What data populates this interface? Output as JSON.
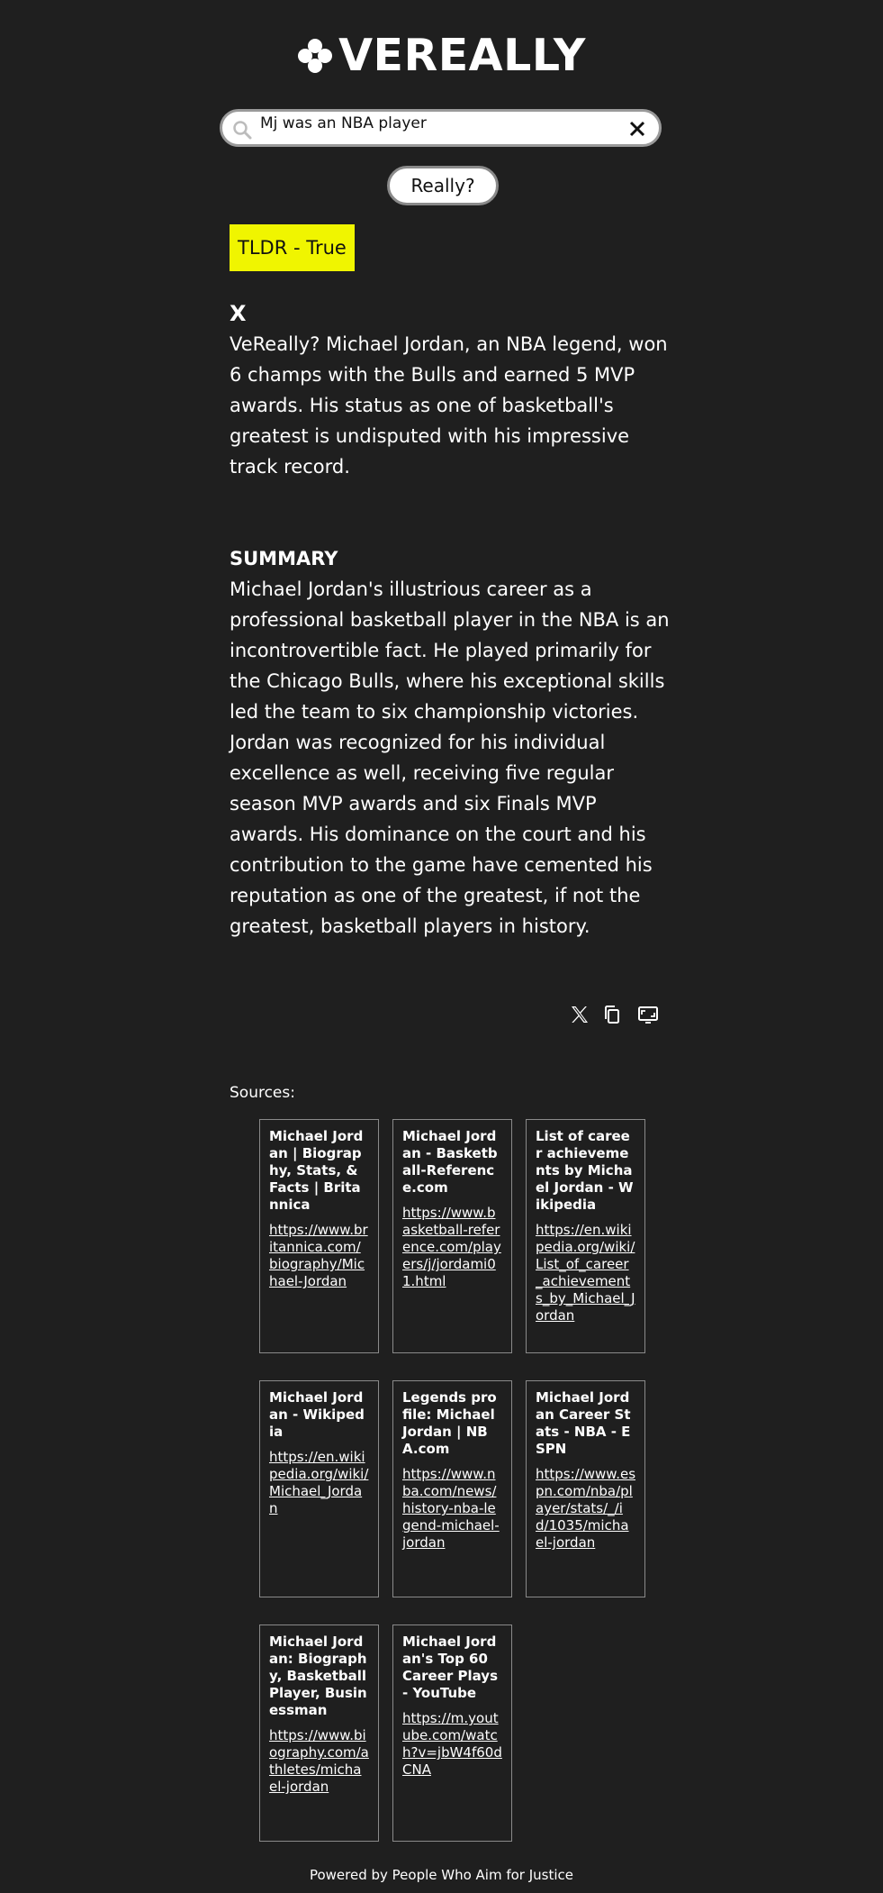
{
  "brand": {
    "name": "VEREALLY"
  },
  "search": {
    "value": "Mj was an NBA player"
  },
  "really_button": {
    "label": "Really?"
  },
  "tldr": {
    "label": "TLDR - True"
  },
  "tweet": {
    "marker": "X",
    "text": "VeReally? Michael Jordan, an NBA legend, won 6 champs with the Bulls and earned 5 MVP awards. His status as one of basketball's greatest is undisputed with his impressive track record."
  },
  "summary": {
    "heading": "SUMMARY",
    "text": "Michael Jordan's illustrious career as a professional basketball player in the NBA is an incontrovertible fact. He played primarily for the Chicago Bulls, where his exceptional skills led the team to six championship victories. Jordan was recognized for his individual excellence as well, receiving five regular season MVP awards and six Finals MVP awards. His dominance on the court and his contribution to the game have cemented his reputation as one of the greatest, if not the greatest, basketball players in history."
  },
  "share_icons": [
    "x-icon",
    "copy-icon",
    "screen-icon"
  ],
  "sources": {
    "label": "Sources:",
    "items": [
      {
        "title": "Michael Jordan | Biography, Stats, & Facts | Britannica",
        "url": "https://www.britannica.com/biography/Michael-Jordan"
      },
      {
        "title": "Michael Jordan - Basketball-Reference.com",
        "url": "https://www.basketball-reference.com/players/j/jordami01.html"
      },
      {
        "title": "List of career achievements by Michael Jordan - Wikipedia",
        "url": "https://en.wikipedia.org/wiki/List_of_career_achievements_by_Michael_Jordan"
      },
      {
        "title": "Michael Jordan - Wikipedia",
        "url": "https://en.wikipedia.org/wiki/Michael_Jordan"
      },
      {
        "title": "Legends profile: Michael Jordan | NBA.com",
        "url": "https://www.nba.com/news/history-nba-legend-michael-jordan"
      },
      {
        "title": "Michael Jordan Career Stats - NBA - ESPN",
        "url": "https://www.espn.com/nba/player/stats/_/id/1035/michael-jordan"
      },
      {
        "title": "Michael Jordan: Biography, Basketball Player, Businessman",
        "url": "https://www.biography.com/athletes/michael-jordan"
      },
      {
        "title": "Michael Jordan's Top 60 Career Plays - YouTube",
        "url": "https://m.youtube.com/watch?v=jbW4f60dCNA"
      }
    ]
  },
  "footer": {
    "text": "Powered by People Who Aim for Justice"
  },
  "colors": {
    "background": "#1f1f1f",
    "tldr_bg": "#f0f500",
    "text": "#ffffff"
  }
}
